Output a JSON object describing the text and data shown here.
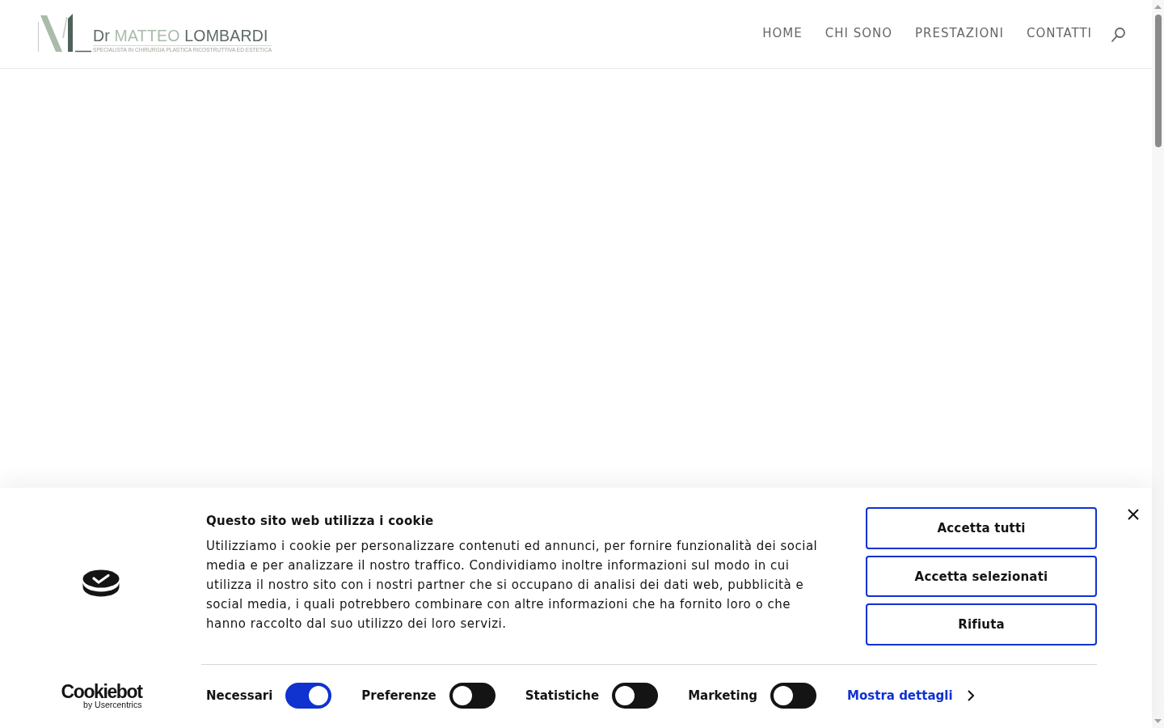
{
  "header": {
    "logo": {
      "name": "Dr MATTEO LOMBARDI",
      "tagline": "SPECIALISTA IN CHIRURGIA PLASTICA RICOSTRUTTIVA ED ESTETICA"
    },
    "nav": [
      "HOME",
      "CHI SONO",
      "PRESTAZIONI",
      "CONTATTI"
    ]
  },
  "cookie_banner": {
    "title": "Questo sito web utilizza i cookie",
    "text": "Utilizziamo i cookie per personalizzare contenuti ed annunci, per fornire funzionalità dei social media e per analizzare il nostro traffico. Condividiamo inoltre informazioni sul modo in cui utilizza il nostro sito con i nostri partner che si occupano di analisi dei dati web, pubblicità e social media, i quali potrebbero combinare con altre informazioni che ha fornito loro o che hanno raccolto dal suo utilizzo dei loro servizi.",
    "buttons": [
      "Accetta tutti",
      "Accetta selezionati",
      "Rifiuta"
    ],
    "categories": [
      {
        "label": "Necessari",
        "on": true
      },
      {
        "label": "Preferenze",
        "on": false
      },
      {
        "label": "Statistiche",
        "on": false
      },
      {
        "label": "Marketing",
        "on": false
      }
    ],
    "details_link": "Mostra dettagli",
    "branding": {
      "name": "Cookiebot",
      "byline": "by Usercentrics"
    }
  }
}
